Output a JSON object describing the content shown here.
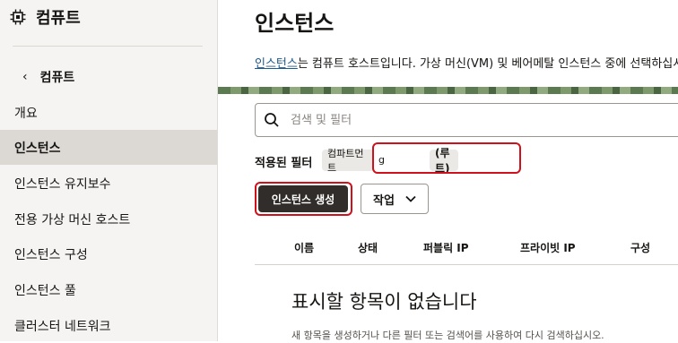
{
  "sidebar": {
    "title": "컴퓨트",
    "back_label": "컴퓨트",
    "items": [
      {
        "label": "개요"
      },
      {
        "label": "인스턴스"
      },
      {
        "label": "인스턴스 유지보수"
      },
      {
        "label": "전용 가상 머신 호스트"
      },
      {
        "label": "인스턴스 구성"
      },
      {
        "label": "인스턴스 풀"
      },
      {
        "label": "클러스터 네트워크"
      }
    ],
    "active_item": "인스턴스"
  },
  "main": {
    "title": "인스턴스",
    "description_link": "인스턴스",
    "description_rest": "는 컴퓨트 호스트입니다. 가상 머신(VM) 및 베어메탈 인스턴스 중에 선택하십시",
    "search_placeholder": "검색 및 필터",
    "filters_label": "적용된 필터",
    "filter_chip_compartment": "컴파트먼트",
    "filter_chip_partial": "g",
    "filter_chip_root": "(루트)",
    "create_button": "인스턴스 생성",
    "actions_button": "작업",
    "columns": [
      "이름",
      "상태",
      "퍼블릭 IP",
      "프라이빗 IP",
      "구성"
    ],
    "empty_title": "표시할 항목이 없습니다",
    "empty_subtitle": "새 항목을 생성하거나 다른 필터 또는 검색어를 사용하여 다시 검색하십시오."
  },
  "colors": {
    "sidebar_bg": "#f5f4f2",
    "active_item_bg": "#dcd9d5",
    "primary_button": "#312d2a",
    "link": "#1d5a90",
    "highlight": "#d0101a"
  },
  "icons": {
    "header": "chip-icon",
    "back": "chevron-left-icon",
    "search": "search-icon",
    "actions": "chevron-down-icon"
  }
}
